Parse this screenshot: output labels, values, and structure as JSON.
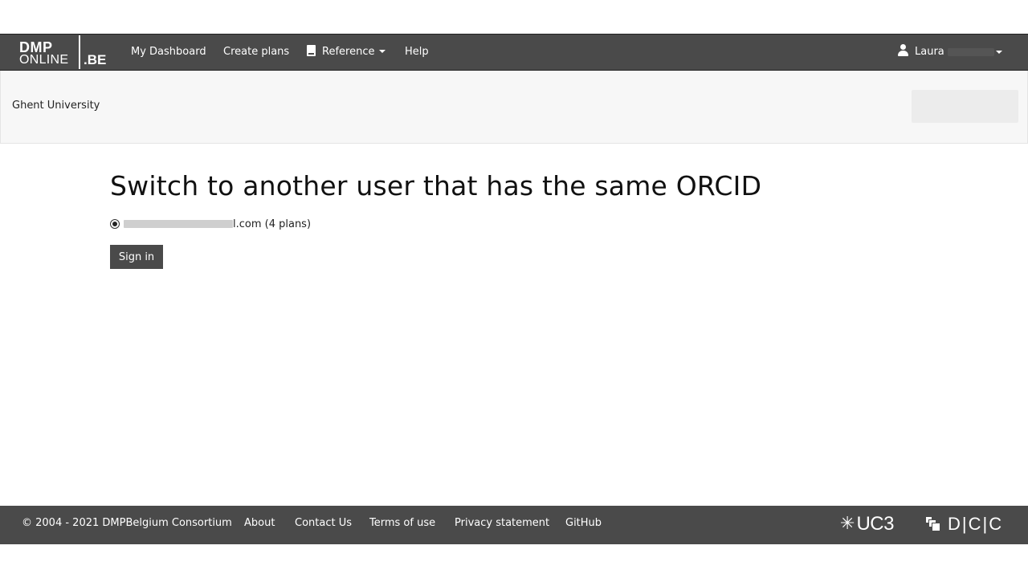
{
  "navbar": {
    "logo": {
      "line1": "DMP",
      "line2": "ONLINE",
      "suffix": ".BE"
    },
    "links": {
      "dashboard": "My Dashboard",
      "create_plans": "Create plans",
      "reference": "Reference",
      "help": "Help"
    },
    "user": {
      "name": "Laura"
    }
  },
  "org": {
    "name": "Ghent University"
  },
  "main": {
    "title": "Switch to another user that has the same ORCID",
    "option": {
      "email_visible_part": "l.com (4 plans)",
      "selected": true
    },
    "signin_label": "Sign in"
  },
  "footer": {
    "copyright": "© 2004 - 2021 DMPBelgium Consortium",
    "links": {
      "about": "About",
      "contact": "Contact Us",
      "terms": "Terms of use",
      "privacy": "Privacy statement",
      "github": "GitHub"
    },
    "logos": {
      "uc3": "UC3",
      "dcc": "D|C|C"
    }
  },
  "colors": {
    "nav_bg": "#4a4a4a",
    "org_bg": "#f7f7f7",
    "button_bg": "#4a4a4a"
  },
  "icons": {
    "reference": "book-icon",
    "user": "user-icon",
    "dropdown": "caret-down-icon"
  }
}
